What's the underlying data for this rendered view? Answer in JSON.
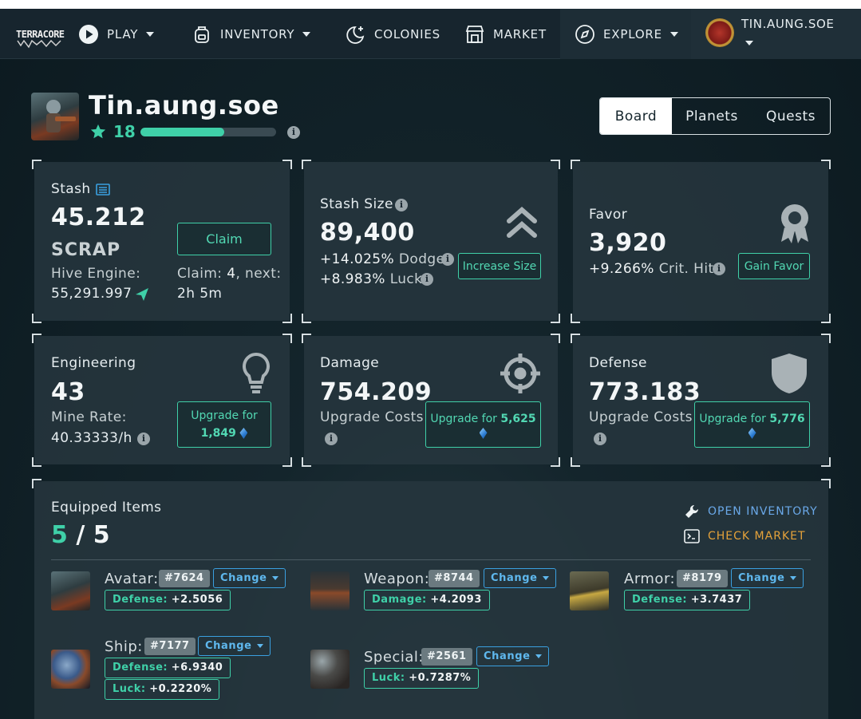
{
  "nav": {
    "logo_text": "TERRACORE",
    "items": [
      {
        "label": "PLAY",
        "icon": "play-icon",
        "dropdown": true
      },
      {
        "label": "INVENTORY",
        "icon": "backpack-icon",
        "dropdown": true
      },
      {
        "label": "COLONIES",
        "icon": "moon-stars-icon",
        "dropdown": false
      },
      {
        "label": "MARKET",
        "icon": "store-icon",
        "dropdown": false
      },
      {
        "label": "EXPLORE",
        "icon": "compass-icon",
        "dropdown": true
      }
    ],
    "user": {
      "name": "TIN.AUNG.SOE"
    }
  },
  "profile": {
    "name": "Tin.aung.soe",
    "level": "18",
    "xp_progress": 0.62
  },
  "tabs": [
    "Board",
    "Planets",
    "Quests"
  ],
  "active_tab": "Board",
  "stash": {
    "title": "Stash",
    "value": "45.212",
    "unit": "SCRAP",
    "hive_label": "Hive Engine:",
    "hive_value": "55,291.997",
    "claim_button": "Claim",
    "claim_label": "Claim:",
    "claim_count": "4",
    "claim_next": ", next:",
    "claim_time": "2h 5m"
  },
  "stash_size": {
    "title": "Stash Size",
    "value": "89,400",
    "dodge_value": "+14.025%",
    "dodge_label": "Dodge",
    "luck_value": "+8.983%",
    "luck_label": "Luck",
    "button": "Increase Size"
  },
  "favor": {
    "title": "Favor",
    "value": "3,920",
    "crit_value": "+9.266%",
    "crit_label": "Crit. Hit",
    "button": "Gain Favor"
  },
  "engineering": {
    "title": "Engineering",
    "value": "43",
    "rate_label": "Mine Rate:",
    "rate_value": "40.33333/h",
    "button_label": "Upgrade for",
    "button_amount": "1,849"
  },
  "damage": {
    "title": "Damage",
    "value": "754.209",
    "cost_label": "Upgrade Costs",
    "button_label": "Upgrade for",
    "button_amount": "5,625"
  },
  "defense": {
    "title": "Defense",
    "value": "773.183",
    "cost_label": "Upgrade Costs",
    "button_label": "Upgrade for",
    "button_amount": "5,776"
  },
  "equipped": {
    "title": "Equipped Items",
    "count": "5",
    "separator": "/",
    "total": "5",
    "open_inventory": "OPEN INVENTORY",
    "check_market": "CHECK MARKET",
    "change_label": "Change",
    "slots": [
      {
        "name": "Avatar:",
        "id": "#7624",
        "stats": [
          {
            "k": "Defense:",
            "v": "+2.5056"
          }
        ]
      },
      {
        "name": "Weapon:",
        "id": "#8744",
        "stats": [
          {
            "k": "Damage:",
            "v": "+4.2093"
          }
        ]
      },
      {
        "name": "Armor:",
        "id": "#8179",
        "stats": [
          {
            "k": "Defense:",
            "v": "+3.7437"
          }
        ]
      },
      {
        "name": "Ship:",
        "id": "#7177",
        "stats": [
          {
            "k": "Defense:",
            "v": "+6.9340"
          },
          {
            "k": "Luck:",
            "v": "+0.2220%"
          }
        ]
      },
      {
        "name": "Special:",
        "id": "#2561",
        "stats": [
          {
            "k": "Luck:",
            "v": "+0.7287%"
          }
        ]
      }
    ]
  },
  "colors": {
    "accent_green": "#3fd0a8",
    "accent_blue": "#5fb8ee",
    "market_orange": "#e5a23a",
    "inventory_blue": "#6aa8e8"
  }
}
